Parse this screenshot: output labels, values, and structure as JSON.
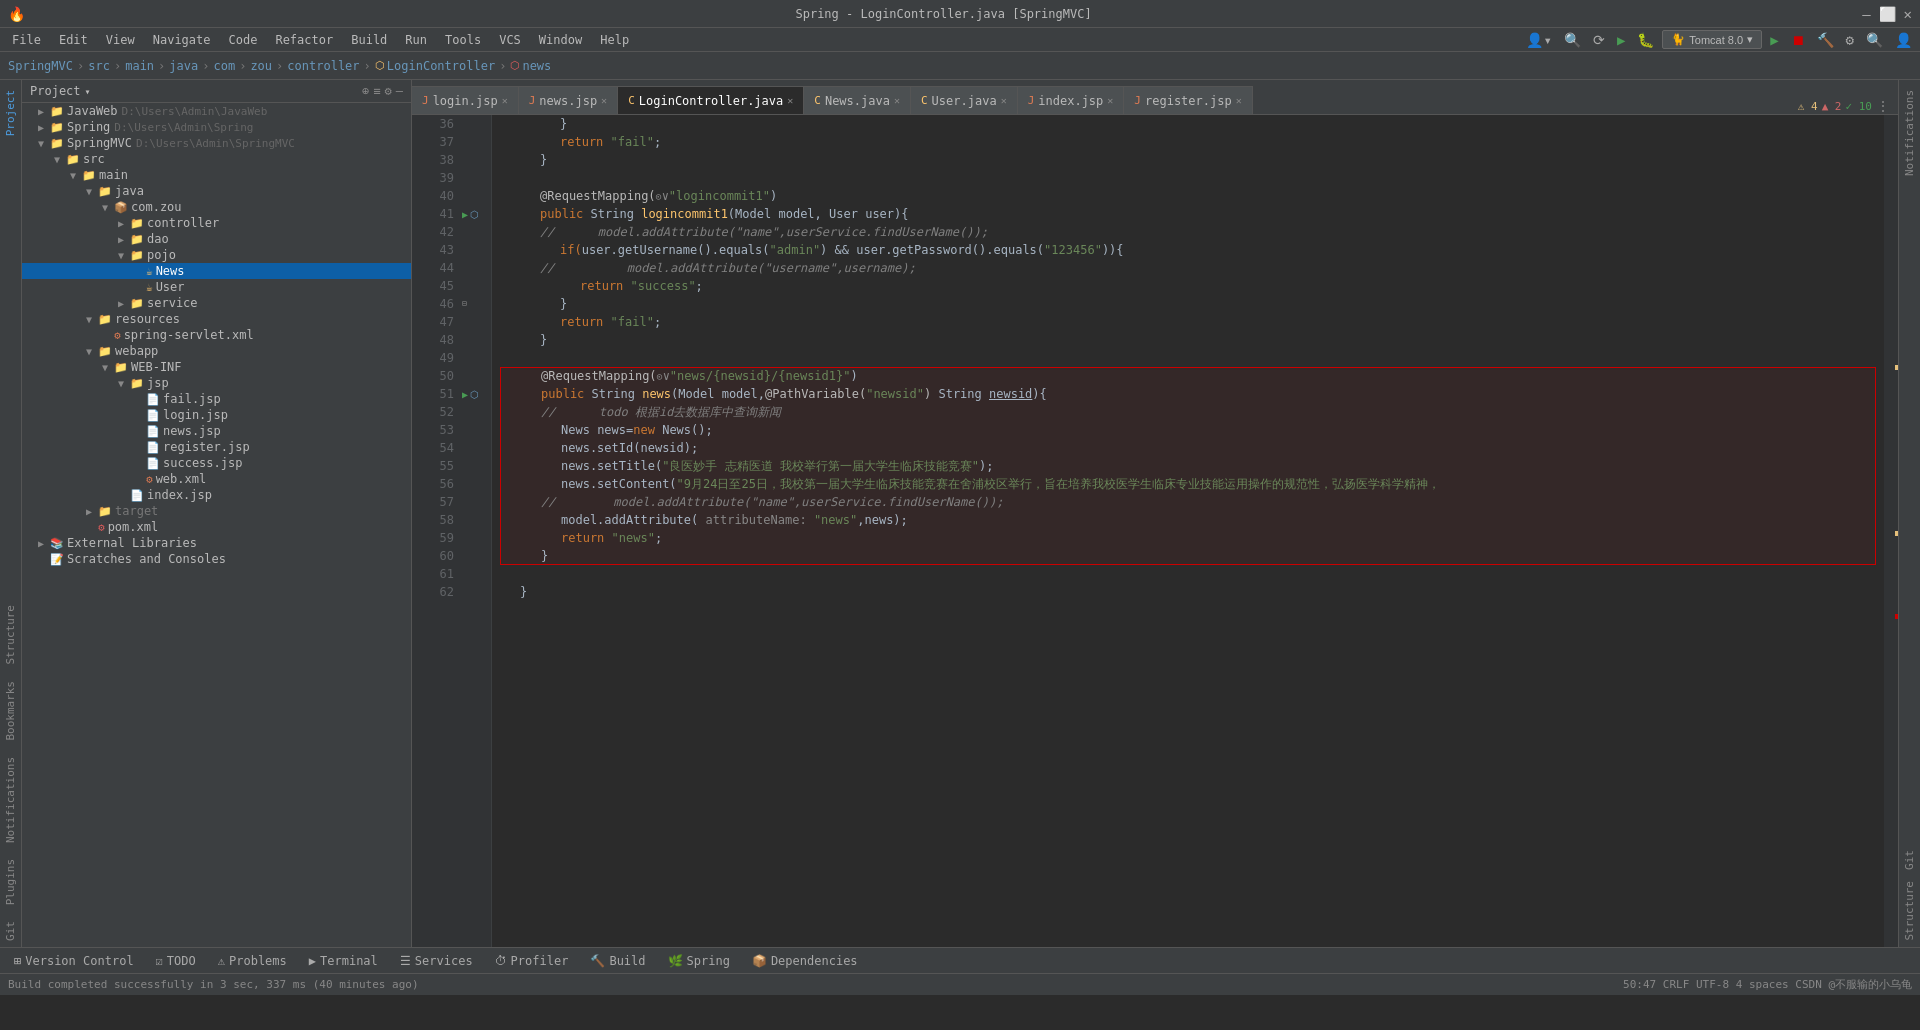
{
  "titleBar": {
    "title": "Spring - LoginController.java [SpringMVC]",
    "logo": "🔥",
    "btnMinimize": "—",
    "btnMaximize": "⬜",
    "btnClose": "✕"
  },
  "menuBar": {
    "items": [
      "File",
      "Edit",
      "View",
      "Navigate",
      "Code",
      "Refactor",
      "Build",
      "Run",
      "Tools",
      "VCS",
      "Window",
      "Help"
    ]
  },
  "breadcrumb": {
    "items": [
      "SpringMVC",
      "src",
      "main",
      "java",
      "com",
      "zou",
      "controller",
      "LoginController",
      "news"
    ]
  },
  "toolbar": {
    "tomcat": "Tomcat 8.0",
    "icons": [
      "▶",
      "⏹",
      "↩",
      "⚙"
    ]
  },
  "fileTree": {
    "title": "Project",
    "nodes": [
      {
        "id": "javaWeb",
        "label": "JavaWeb",
        "path": "D:\\Users\\Admin\\JavaWeb",
        "indent": 0,
        "type": "folder",
        "open": true
      },
      {
        "id": "spring",
        "label": "Spring",
        "path": "D:\\Users\\Admin\\Spring",
        "indent": 0,
        "type": "folder",
        "open": true
      },
      {
        "id": "springmvc",
        "label": "SpringMVC",
        "path": "D:\\Users\\Admin\\SpringMVC",
        "indent": 0,
        "type": "folder",
        "open": true
      },
      {
        "id": "src",
        "label": "src",
        "indent": 1,
        "type": "folder",
        "open": true
      },
      {
        "id": "main",
        "label": "main",
        "indent": 2,
        "type": "folder",
        "open": true
      },
      {
        "id": "java",
        "label": "java",
        "indent": 3,
        "type": "folder",
        "open": true
      },
      {
        "id": "comzou",
        "label": "com.zou",
        "indent": 4,
        "type": "package",
        "open": true
      },
      {
        "id": "controller",
        "label": "controller",
        "indent": 5,
        "type": "folder",
        "open": true
      },
      {
        "id": "dao",
        "label": "dao",
        "indent": 5,
        "type": "folder",
        "open": false
      },
      {
        "id": "pojo",
        "label": "pojo",
        "indent": 5,
        "type": "folder",
        "open": true
      },
      {
        "id": "news",
        "label": "News",
        "indent": 6,
        "type": "class",
        "open": false,
        "selected": true
      },
      {
        "id": "user",
        "label": "User",
        "indent": 6,
        "type": "class",
        "open": false
      },
      {
        "id": "service",
        "label": "service",
        "indent": 5,
        "type": "folder",
        "open": false
      },
      {
        "id": "resources",
        "label": "resources",
        "indent": 3,
        "type": "folder",
        "open": true
      },
      {
        "id": "springservlet",
        "label": "spring-servlet.xml",
        "indent": 4,
        "type": "xml"
      },
      {
        "id": "webapp",
        "label": "webapp",
        "indent": 3,
        "type": "folder",
        "open": true
      },
      {
        "id": "webinf",
        "label": "WEB-INF",
        "indent": 4,
        "type": "folder",
        "open": true
      },
      {
        "id": "jsp",
        "label": "jsp",
        "indent": 5,
        "type": "folder",
        "open": true
      },
      {
        "id": "failjsp",
        "label": "fail.jsp",
        "indent": 6,
        "type": "jsp"
      },
      {
        "id": "loginjsp",
        "label": "login.jsp",
        "indent": 6,
        "type": "jsp"
      },
      {
        "id": "newsjsp",
        "label": "news.jsp",
        "indent": 6,
        "type": "jsp"
      },
      {
        "id": "registerjsp",
        "label": "register.jsp",
        "indent": 6,
        "type": "jsp"
      },
      {
        "id": "successjsp",
        "label": "success.jsp",
        "indent": 6,
        "type": "jsp"
      },
      {
        "id": "webxml",
        "label": "web.xml",
        "indent": 6,
        "type": "xml"
      },
      {
        "id": "indexjsp",
        "label": "index.jsp",
        "indent": 5,
        "type": "jsp"
      },
      {
        "id": "target",
        "label": "target",
        "indent": 3,
        "type": "folder",
        "open": false
      },
      {
        "id": "pomxml",
        "label": "pom.xml",
        "indent": 3,
        "type": "xml"
      },
      {
        "id": "extlibs",
        "label": "External Libraries",
        "indent": 0,
        "type": "folder",
        "open": false
      },
      {
        "id": "scratches",
        "label": "Scratches and Consoles",
        "indent": 0,
        "type": "scratches"
      }
    ]
  },
  "tabs": [
    {
      "label": "login.jsp",
      "icon": "J",
      "active": false,
      "modified": false
    },
    {
      "label": "news.jsp",
      "icon": "J",
      "active": false,
      "modified": false
    },
    {
      "label": "LoginController.java",
      "icon": "C",
      "active": true,
      "modified": false
    },
    {
      "label": "News.java",
      "icon": "C",
      "active": false,
      "modified": false
    },
    {
      "label": "User.java",
      "icon": "C",
      "active": false,
      "modified": false
    },
    {
      "label": "index.jsp",
      "icon": "J",
      "active": false,
      "modified": false
    },
    {
      "label": "register.jsp",
      "icon": "J",
      "active": false,
      "modified": false
    }
  ],
  "codeLines": [
    {
      "num": 36,
      "content": "            }"
    },
    {
      "num": 37,
      "content": "            return \"fail\";"
    },
    {
      "num": 38,
      "content": "        }"
    },
    {
      "num": 39,
      "content": ""
    },
    {
      "num": 40,
      "content": "        @RequestMapping(☉∨\"logincommit1\")"
    },
    {
      "num": 41,
      "content": "        public String logincommit1(Model model, User user){",
      "hasIcons": true
    },
    {
      "num": 42,
      "content": "//          model.addAttribute(\"name\",userService.findUserName());"
    },
    {
      "num": 43,
      "content": "            if(user.getUsername().equals(\"admin\") && user.getPassword().equals(\"123456\")){"
    },
    {
      "num": 44,
      "content": "//              model.addAttribute(\"username\",username);"
    },
    {
      "num": 45,
      "content": "                return \"success\";"
    },
    {
      "num": 46,
      "content": "            }"
    },
    {
      "num": 47,
      "content": "            return \"fail\";"
    },
    {
      "num": 48,
      "content": "        }"
    },
    {
      "num": 49,
      "content": ""
    },
    {
      "num": 50,
      "content": "        @RequestMapping(☉∨\"news/{newsid}/{newsid1}\")",
      "highlight": true,
      "highlightTop": true
    },
    {
      "num": 51,
      "content": "        public String news(Model model,@PathVariable(\"newsid\") String newsid){",
      "highlight": true,
      "hasIcons": true
    },
    {
      "num": 52,
      "content": "//          todo 根据id去数据库中查询新闻",
      "highlight": true
    },
    {
      "num": 53,
      "content": "            News news=new News();",
      "highlight": true
    },
    {
      "num": 54,
      "content": "            news.setId(newsid);",
      "highlight": true
    },
    {
      "num": 55,
      "content": "            news.setTitle(\"良医妙手 志精医道 我校举行第一届大学生临床技能竞赛\");",
      "highlight": true
    },
    {
      "num": 56,
      "content": "            news.setContent(\"9月24日至25日，我校第一届大学生临床技能竞赛在舍浦校区举行，旨在培养我校医学生临床专业技能运用操作的规范性，弘扬医学科学精神，",
      "highlight": true
    },
    {
      "num": 57,
      "content": "//              model.addAttribute(\"name\",userService.findUserName());",
      "highlight": true
    },
    {
      "num": 58,
      "content": "            model.addAttribute( attributeName: \"news\",news);",
      "highlight": true
    },
    {
      "num": 59,
      "content": "            return \"news\";",
      "highlight": true
    },
    {
      "num": 60,
      "content": "        }",
      "highlight": true,
      "highlightBottom": true
    },
    {
      "num": 61,
      "content": ""
    },
    {
      "num": 62,
      "content": "    }"
    }
  ],
  "bottomTabs": [
    {
      "label": "Version Control",
      "icon": "⊞"
    },
    {
      "label": "TODO",
      "icon": "☑"
    },
    {
      "label": "Problems",
      "icon": "⚠"
    },
    {
      "label": "Terminal",
      "icon": "▶"
    },
    {
      "label": "Services",
      "icon": "☰"
    },
    {
      "label": "Profiler",
      "icon": "⏱"
    },
    {
      "label": "Build",
      "icon": "🔨"
    },
    {
      "label": "Spring",
      "icon": "🌿"
    },
    {
      "label": "Dependencies",
      "icon": "📦"
    }
  ],
  "statusBar": {
    "left": "Build completed successfully in 3 sec, 337 ms (40 minutes ago)",
    "right": "50:47  CRLF  UTF-8  4 spaces  CSDN @不服输的小乌龟"
  },
  "warnings": {
    "label1": "⚠ 4",
    "label2": "▲ 2",
    "label3": "✓ 10"
  },
  "sidebarItems": {
    "project": "Project",
    "structure": "Structure",
    "bookmarks": "Bookmarks",
    "notifications": "Notifications",
    "plugins": "Plugins",
    "git": "Git"
  }
}
